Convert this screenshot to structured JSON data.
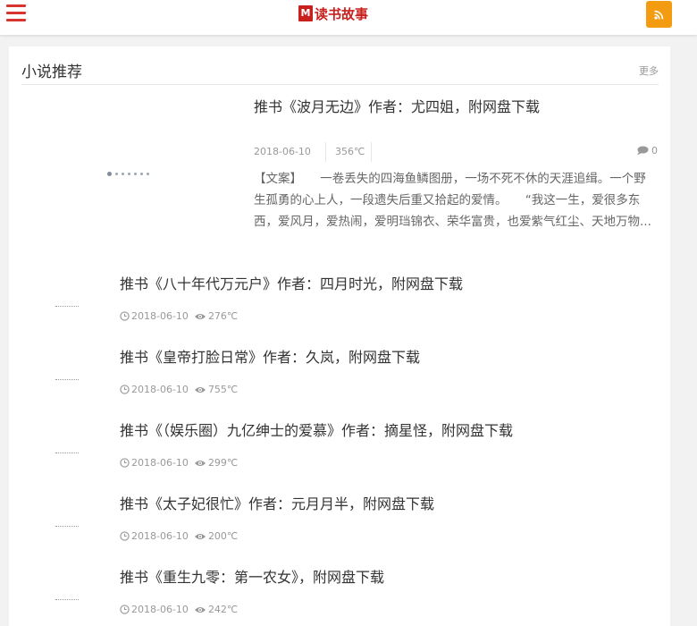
{
  "header": {
    "menu_icon": "hamburger-menu-icon",
    "logo_mark": "M",
    "logo_text": "读书故事",
    "rss_icon": "rss-icon",
    "colors": {
      "brand": "#c8201d",
      "rss": "#f39c12"
    }
  },
  "section": {
    "title": "小说推荐",
    "more": "更多"
  },
  "featured": {
    "title": "推书《波月无边》作者：尤四姐，附网盘下载",
    "date": "2018-06-10",
    "temperature": "356℃",
    "comments": "0",
    "excerpt": "【文案】　　一卷丢失的四海鱼鳞图册，一场不死不休的天涯追缉。一个野生孤勇的心上人，一段遗失后重又拾起的爱情。　　“我这一生，爱很多东西，爱风月，爱热闹，爱明珰锦衣、荣华富贵，也爱紫气红尘、天地万物...",
    "carousel_slides": 7,
    "carousel_active": 1
  },
  "items": [
    {
      "title": "推书《八十年代万元户》作者：四月时光，附网盘下载",
      "date": "2018-06-10",
      "temperature": "276℃"
    },
    {
      "title": "推书《皇帝打脸日常》作者：久岚，附网盘下载",
      "date": "2018-06-10",
      "temperature": "755℃"
    },
    {
      "title": "推书《（娱乐圈）九亿绅士的爱慕》作者：摘星怪，附网盘下载",
      "date": "2018-06-10",
      "temperature": "299℃"
    },
    {
      "title": "推书《太子妃很忙》作者：元月月半，附网盘下载",
      "date": "2018-06-10",
      "temperature": "200℃"
    },
    {
      "title": "推书《重生九零：第一农女》，附网盘下载",
      "date": "2018-06-10",
      "temperature": "242℃"
    }
  ]
}
